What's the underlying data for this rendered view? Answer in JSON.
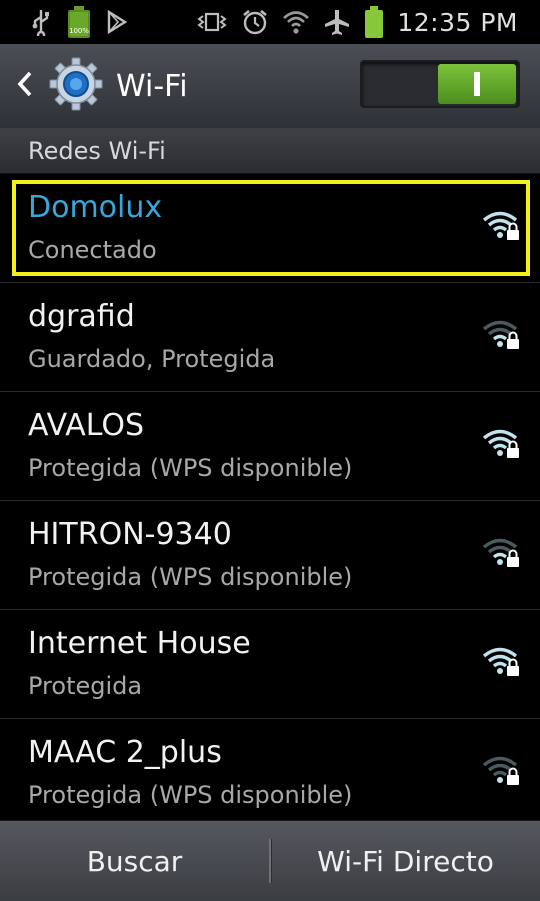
{
  "status_bar": {
    "time": "12:35 PM",
    "battery_percent_label": "100%",
    "icons_left": [
      "usb-icon",
      "battery-full-icon",
      "play-store-icon"
    ],
    "icons_right": [
      "vibrate-icon",
      "alarm-icon",
      "wifi-signal-icon",
      "airplane-mode-icon",
      "battery-charging-icon"
    ]
  },
  "header": {
    "title": "Wi-Fi",
    "back_icon": "back-arrow-icon",
    "settings_icon": "gear-icon",
    "toggle_state": "on"
  },
  "section": {
    "label": "Redes Wi-Fi"
  },
  "networks": [
    {
      "name": "Domolux",
      "status": "Conectado",
      "connected": true,
      "signal": "strong",
      "secured": true
    },
    {
      "name": "dgrafid",
      "status": "Guardado, Protegida",
      "connected": false,
      "signal": "weak",
      "secured": true
    },
    {
      "name": "AVALOS",
      "status": "Protegida (WPS disponible)",
      "connected": false,
      "signal": "strong",
      "secured": true
    },
    {
      "name": "HITRON-9340",
      "status": "Protegida (WPS disponible)",
      "connected": false,
      "signal": "weak",
      "secured": true
    },
    {
      "name": "Internet House",
      "status": "Protegida",
      "connected": false,
      "signal": "strong",
      "secured": true
    },
    {
      "name": "MAAC 2_plus",
      "status": "Protegida (WPS disponible)",
      "connected": false,
      "signal": "weak",
      "secured": true
    }
  ],
  "bottom_bar": {
    "scan_label": "Buscar",
    "wifi_direct_label": "Wi-Fi Directo"
  },
  "colors": {
    "connected_name": "#37a6d8",
    "highlight_border": "#f2f21a",
    "toggle_on": "#5fa82a",
    "wifi_strong": "#bfe4ee",
    "wifi_weak": "#4a5a5e"
  }
}
